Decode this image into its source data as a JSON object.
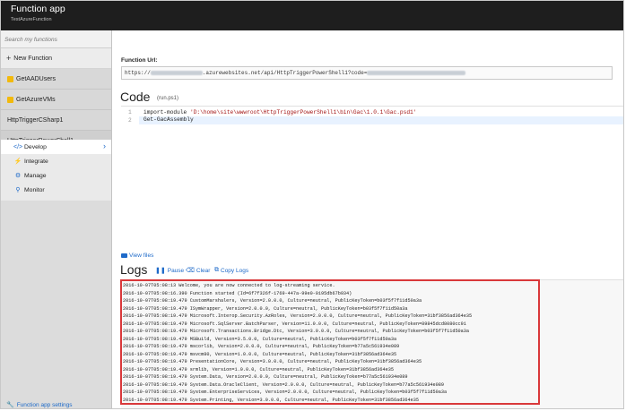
{
  "header": {
    "title": "Function app",
    "subtitle": "TestAzureFunction"
  },
  "sidebar": {
    "search_placeholder": "Search my functions",
    "new_function": "New Function",
    "functions": [
      {
        "label": "GetAADUsers"
      },
      {
        "label": "GetAzureVMs"
      },
      {
        "label": "HttpTriggerCSharp1"
      },
      {
        "label": "HttpTriggerPowerShell1"
      }
    ],
    "subnav": [
      {
        "label": "Develop",
        "icon": "code-icon",
        "selected": true
      },
      {
        "label": "Integrate",
        "icon": "lightning-icon"
      },
      {
        "label": "Manage",
        "icon": "gear-icon"
      },
      {
        "label": "Monitor",
        "icon": "magnifier-icon"
      }
    ],
    "app_settings": "Function app settings"
  },
  "main": {
    "url_label": "Function Url:",
    "url_prefix": "https://",
    "url_middle": ".azurewebsites.net/api/HttpTriggerPowerShell1?code=",
    "code_title": "Code",
    "code_file": "(run.ps1)",
    "code_lines": [
      {
        "num": "1",
        "keyword": "import-module ",
        "string": "'D:\\home\\site\\wwwroot\\HttpTriggerPowerShell1\\bin\\Gac\\1.0.1\\Gac.psd1'"
      },
      {
        "num": "2",
        "text": "Get-GacAssembly"
      }
    ],
    "view_files": "View files",
    "logs_title": "Logs",
    "pause_label": "Pause",
    "clear_label": "Clear",
    "copy_label": "Copy Logs",
    "log_lines": [
      "2016-10-07T05:08:13  Welcome, you are now connected to log-streaming service.",
      "2016-10-07T05:08:16.390 Function started (Id=6f7f326f-1769-447a-99e0-0195db67b934)",
      "2016-10-07T05:08:19.479 CustomMarshalers, Version=2.0.0.0, Culture=neutral, PublicKeyToken=b03f5f7f11d50a3a",
      "2016-10-07T05:08:19.479 ISymWrapper, Version=2.0.0.0, Culture=neutral, PublicKeyToken=b03f5f7f11d50a3a",
      "2016-10-07T05:08:19.479 Microsoft.Interop.Security.AzRoles, Version=2.0.0.0, Culture=neutral, PublicKeyToken=31bf3856ad364e35",
      "2016-10-07T05:08:19.479 Microsoft.SqlServer.BatchParser, Version=11.0.0.0, Culture=neutral, PublicKeyToken=89845dcd8080cc91",
      "2016-10-07T05:08:19.479 Microsoft.Transactions.Bridge.Dtc, Version=3.0.0.0, Culture=neutral, PublicKeyToken=b03f5f7f11d50a3a",
      "2016-10-07T05:08:19.479 MSBuild, Version=3.5.0.0, Culture=neutral, PublicKeyToken=b03f5f7f11d50a3a",
      "2016-10-07T05:08:19.479 mscorlib, Version=2.0.0.0, Culture=neutral, PublicKeyToken=b77a5c561934e089",
      "2016-10-07T05:08:19.479 msvcm80, Version=1.0.0.0, Culture=neutral, PublicKeyToken=31bf3856ad364e35",
      "2016-10-07T05:08:19.479 PresentationCore, Version=3.0.0.0, Culture=neutral, PublicKeyToken=31bf3856ad364e35",
      "2016-10-07T05:08:19.479 srmlib, Version=1.0.0.0, Culture=neutral, PublicKeyToken=31bf3856ad364e35",
      "2016-10-07T05:08:19.479 System.Data, Version=2.0.0.0, Culture=neutral, PublicKeyToken=b77a5c561934e089",
      "2016-10-07T05:08:19.479 System.Data.OracleClient, Version=2.0.0.0, Culture=neutral, PublicKeyToken=b77a5c561934e089",
      "2016-10-07T05:08:19.479 System.EnterpriseServices, Version=2.0.0.0, Culture=neutral, PublicKeyToken=b03f5f7f11d50a3a",
      "2016-10-07T05:08:19.479 System.Printing, Version=3.0.0.0, Culture=neutral, PublicKeyToken=31bf3856ad364e35"
    ]
  },
  "colors": {
    "header_bg": "#1e1e1e",
    "accent": "#1e6ac9",
    "highlight_border": "#d9383a",
    "function_icon": "#f2b90c"
  }
}
